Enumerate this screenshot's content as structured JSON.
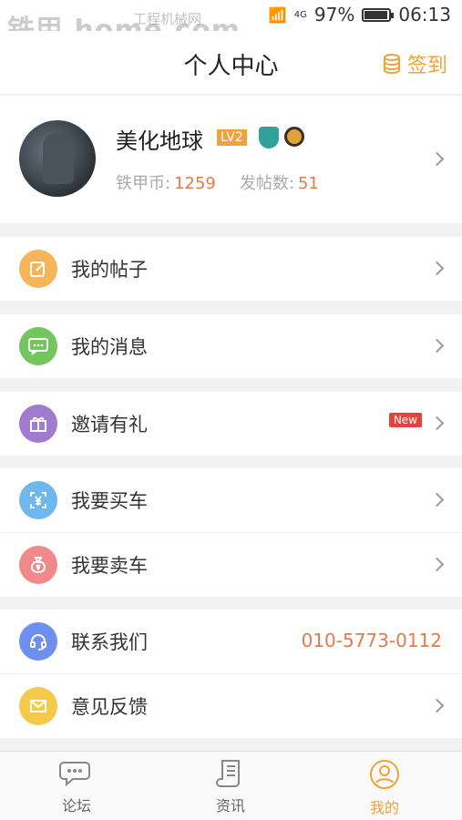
{
  "status_bar": {
    "time": "06:13",
    "battery": "97%",
    "battery_level": 0.97,
    "network": "4G",
    "watermark": "铁甲 home.com",
    "watermark_sub": "工程机械网"
  },
  "header": {
    "title": "个人中心",
    "signin_label": "签到"
  },
  "profile": {
    "username": "美化地球",
    "level": "LV2",
    "coins_label": "铁甲币:",
    "coins": "1259",
    "posts_label": "发帖数:",
    "posts": "51"
  },
  "menu": {
    "my_posts": "我的帖子",
    "my_messages": "我的消息",
    "invite": "邀请有礼",
    "invite_badge": "New",
    "buy_car": "我要买车",
    "sell_car": "我要卖车",
    "contact": "联系我们",
    "contact_phone": "010-5773-0112",
    "feedback": "意见反馈"
  },
  "tabs": [
    {
      "label": "论坛"
    },
    {
      "label": "资讯"
    },
    {
      "label": "我的"
    }
  ],
  "colors": {
    "accent": "#f0a23b",
    "posts_icon": "#f6b55a",
    "messages_icon": "#72c65c",
    "invite_icon": "#a07bd0",
    "buy_icon": "#6fb8ef",
    "sell_icon": "#f08a8a",
    "contact_icon": "#6f8ff0",
    "feedback_icon": "#f5c94a",
    "number_highlight": "#e07b4a"
  }
}
